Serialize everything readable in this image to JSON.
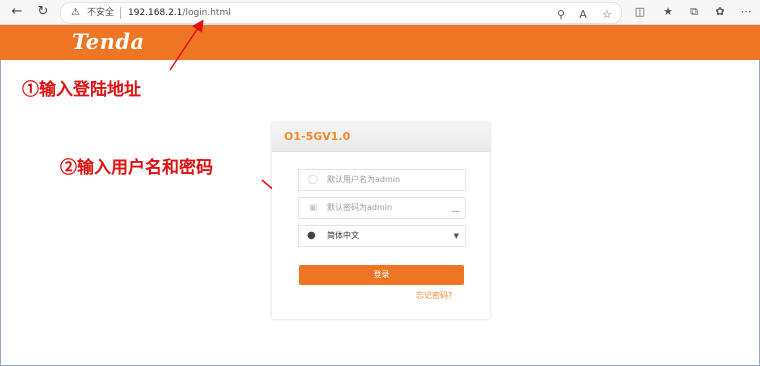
{
  "browser": {
    "security_warning": "不安全",
    "url_host": "192.168.2.1",
    "url_path": "/login.html"
  },
  "header": {
    "brand": "Tenda",
    "brand_color": "#ee7523"
  },
  "annotations": {
    "step1": "①输入登陆地址",
    "step2": "②输入用户名和密码",
    "color": "#e01010"
  },
  "login": {
    "model": "O1-5GV1.0",
    "username_placeholder": "默认用户名为admin",
    "password_placeholder": "默认密码为admin",
    "language": "简体中文",
    "submit_label": "登录",
    "forgot_label": "忘记密码?"
  },
  "icons": [
    "back-icon",
    "refresh-icon",
    "warning-icon",
    "key-icon",
    "read-aloud-icon",
    "favorite-icon",
    "split-screen-icon",
    "favorites-bar-icon",
    "collections-icon",
    "extensions-icon",
    "more-icon",
    "user-icon",
    "lock-icon",
    "eye-icon",
    "location-pin-icon",
    "chevron-down-icon"
  ]
}
